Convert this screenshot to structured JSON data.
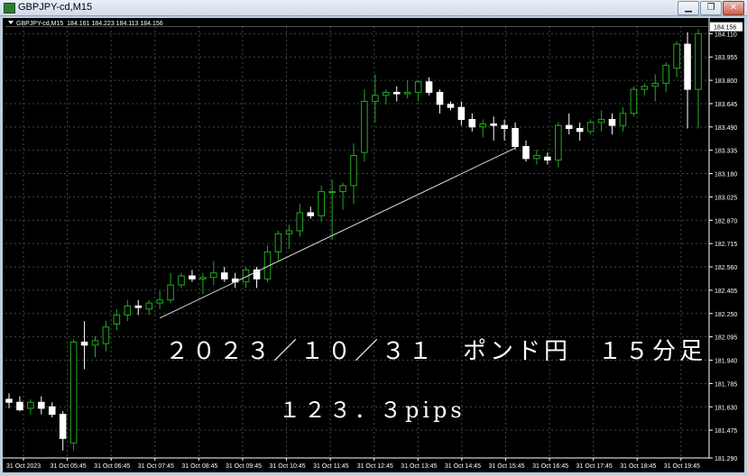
{
  "window": {
    "title": "GBPJPY-cd,M15",
    "buttons": {
      "minimize": "▁",
      "restore": "❐",
      "close": "✕"
    }
  },
  "chart": {
    "symbol_label": "GBPJPY-cd,M15",
    "ohlc_readout": "184.161 184.223 184.113 184.156",
    "current_price": "184.156",
    "price_labels": [
      "184.110",
      "183.955",
      "183.800",
      "183.645",
      "183.490",
      "183.335",
      "183.180",
      "183.025",
      "182.870",
      "182.715",
      "182.560",
      "182.405",
      "182.250",
      "182.095",
      "181.940",
      "181.785",
      "181.630",
      "181.475",
      "181.290"
    ],
    "time_labels": [
      "31 Oct 2023",
      "31 Oct 05:45",
      "31 Oct 06:45",
      "31 Oct 07:45",
      "31 Oct 08:45",
      "31 Oct 09:45",
      "31 Oct 10:45",
      "31 Oct 11:45",
      "31 Oct 12:45",
      "31 Oct 13:45",
      "31 Oct 14:45",
      "31 Oct 15:45",
      "31 Oct 16:45",
      "31 Oct 17:45",
      "31 Oct 18:45",
      "31 Oct 19:45"
    ],
    "colors": {
      "background": "#000000",
      "grid": "#3a4a44",
      "bull": "#1faa1f",
      "bear": "#ffffff",
      "axis_text": "#ffffff"
    }
  },
  "overlay": {
    "line1": "２０２３／１０／３１　ポンド円　１５分足",
    "line2": "１２３．３pips"
  },
  "chart_data": {
    "type": "candlestick",
    "timeframe": "M15",
    "instrument": "GBPJPY-cd",
    "ylim": [
      181.29,
      184.16
    ],
    "candles": [
      {
        "o": 181.68,
        "h": 181.72,
        "l": 181.62,
        "c": 181.66
      },
      {
        "o": 181.66,
        "h": 181.7,
        "l": 181.6,
        "c": 181.61
      },
      {
        "o": 181.62,
        "h": 181.68,
        "l": 181.58,
        "c": 181.66
      },
      {
        "o": 181.66,
        "h": 181.7,
        "l": 181.58,
        "c": 181.62
      },
      {
        "o": 181.63,
        "h": 181.66,
        "l": 181.56,
        "c": 181.58
      },
      {
        "o": 181.58,
        "h": 181.6,
        "l": 181.34,
        "c": 181.42
      },
      {
        "o": 181.39,
        "h": 182.08,
        "l": 181.34,
        "c": 182.06
      },
      {
        "o": 182.06,
        "h": 182.2,
        "l": 181.88,
        "c": 182.04
      },
      {
        "o": 182.04,
        "h": 182.1,
        "l": 181.96,
        "c": 182.07
      },
      {
        "o": 182.05,
        "h": 182.2,
        "l": 182.0,
        "c": 182.16
      },
      {
        "o": 182.18,
        "h": 182.28,
        "l": 182.14,
        "c": 182.24
      },
      {
        "o": 182.24,
        "h": 182.34,
        "l": 182.2,
        "c": 182.3
      },
      {
        "o": 182.3,
        "h": 182.34,
        "l": 182.24,
        "c": 182.29
      },
      {
        "o": 182.28,
        "h": 182.34,
        "l": 182.24,
        "c": 182.32
      },
      {
        "o": 182.32,
        "h": 182.4,
        "l": 182.28,
        "c": 182.34
      },
      {
        "o": 182.34,
        "h": 182.52,
        "l": 182.32,
        "c": 182.44
      },
      {
        "o": 182.44,
        "h": 182.52,
        "l": 182.42,
        "c": 182.5
      },
      {
        "o": 182.5,
        "h": 182.54,
        "l": 182.46,
        "c": 182.48
      },
      {
        "o": 182.48,
        "h": 182.52,
        "l": 182.38,
        "c": 182.49
      },
      {
        "o": 182.49,
        "h": 182.6,
        "l": 182.44,
        "c": 182.52
      },
      {
        "o": 182.52,
        "h": 182.56,
        "l": 182.46,
        "c": 182.48
      },
      {
        "o": 182.48,
        "h": 182.52,
        "l": 182.42,
        "c": 182.46
      },
      {
        "o": 182.46,
        "h": 182.56,
        "l": 182.42,
        "c": 182.54
      },
      {
        "o": 182.54,
        "h": 182.56,
        "l": 182.42,
        "c": 182.48
      },
      {
        "o": 182.48,
        "h": 182.7,
        "l": 182.46,
        "c": 182.66
      },
      {
        "o": 182.66,
        "h": 182.8,
        "l": 182.6,
        "c": 182.78
      },
      {
        "o": 182.78,
        "h": 182.84,
        "l": 182.68,
        "c": 182.8
      },
      {
        "o": 182.8,
        "h": 182.98,
        "l": 182.76,
        "c": 182.92
      },
      {
        "o": 182.92,
        "h": 182.96,
        "l": 182.88,
        "c": 182.9
      },
      {
        "o": 182.9,
        "h": 183.1,
        "l": 182.86,
        "c": 183.06
      },
      {
        "o": 183.06,
        "h": 183.14,
        "l": 182.74,
        "c": 183.06
      },
      {
        "o": 183.06,
        "h": 183.12,
        "l": 182.94,
        "c": 183.1
      },
      {
        "o": 183.1,
        "h": 183.38,
        "l": 182.98,
        "c": 183.3
      },
      {
        "o": 183.32,
        "h": 183.74,
        "l": 183.26,
        "c": 183.66
      },
      {
        "o": 183.66,
        "h": 183.84,
        "l": 183.52,
        "c": 183.7
      },
      {
        "o": 183.7,
        "h": 183.74,
        "l": 183.64,
        "c": 183.72
      },
      {
        "o": 183.72,
        "h": 183.76,
        "l": 183.66,
        "c": 183.71
      },
      {
        "o": 183.71,
        "h": 183.8,
        "l": 183.68,
        "c": 183.72
      },
      {
        "o": 183.72,
        "h": 183.8,
        "l": 183.66,
        "c": 183.79
      },
      {
        "o": 183.79,
        "h": 183.82,
        "l": 183.7,
        "c": 183.72
      },
      {
        "o": 183.72,
        "h": 183.74,
        "l": 183.58,
        "c": 183.64
      },
      {
        "o": 183.64,
        "h": 183.66,
        "l": 183.6,
        "c": 183.62
      },
      {
        "o": 183.62,
        "h": 183.66,
        "l": 183.5,
        "c": 183.54
      },
      {
        "o": 183.54,
        "h": 183.58,
        "l": 183.46,
        "c": 183.49
      },
      {
        "o": 183.49,
        "h": 183.54,
        "l": 183.42,
        "c": 183.51
      },
      {
        "o": 183.51,
        "h": 183.56,
        "l": 183.4,
        "c": 183.5
      },
      {
        "o": 183.5,
        "h": 183.54,
        "l": 183.4,
        "c": 183.48
      },
      {
        "o": 183.48,
        "h": 183.52,
        "l": 183.34,
        "c": 183.36
      },
      {
        "o": 183.36,
        "h": 183.4,
        "l": 183.26,
        "c": 183.28
      },
      {
        "o": 183.28,
        "h": 183.34,
        "l": 183.24,
        "c": 183.3
      },
      {
        "o": 183.29,
        "h": 183.32,
        "l": 183.24,
        "c": 183.27
      },
      {
        "o": 183.27,
        "h": 183.52,
        "l": 183.22,
        "c": 183.5
      },
      {
        "o": 183.5,
        "h": 183.58,
        "l": 183.44,
        "c": 183.48
      },
      {
        "o": 183.48,
        "h": 183.52,
        "l": 183.4,
        "c": 183.46
      },
      {
        "o": 183.46,
        "h": 183.54,
        "l": 183.44,
        "c": 183.52
      },
      {
        "o": 183.52,
        "h": 183.6,
        "l": 183.46,
        "c": 183.54
      },
      {
        "o": 183.54,
        "h": 183.58,
        "l": 183.44,
        "c": 183.5
      },
      {
        "o": 183.5,
        "h": 183.62,
        "l": 183.46,
        "c": 183.58
      },
      {
        "o": 183.58,
        "h": 183.76,
        "l": 183.56,
        "c": 183.74
      },
      {
        "o": 183.74,
        "h": 183.78,
        "l": 183.7,
        "c": 183.76
      },
      {
        "o": 183.76,
        "h": 183.84,
        "l": 183.66,
        "c": 183.78
      },
      {
        "o": 183.78,
        "h": 183.92,
        "l": 183.72,
        "c": 183.9
      },
      {
        "o": 183.88,
        "h": 184.06,
        "l": 183.82,
        "c": 184.04
      },
      {
        "o": 184.04,
        "h": 184.12,
        "l": 183.48,
        "c": 183.74
      },
      {
        "o": 183.74,
        "h": 184.14,
        "l": 183.48,
        "c": 184.11
      }
    ],
    "trendline": {
      "from": 182.22,
      "to": 183.35
    }
  }
}
